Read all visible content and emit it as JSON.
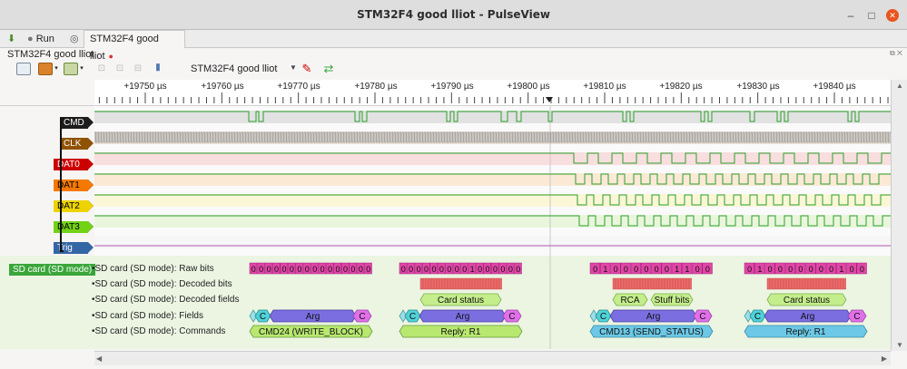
{
  "window": {
    "title": "STM32F4 good lliot - PulseView",
    "buttons": [
      "minimize",
      "maximize",
      "close"
    ]
  },
  "tabs": {
    "run_label": "Run",
    "session_tab": "STM32F4 good lliot"
  },
  "session": {
    "title": "STM32F4 good lliot"
  },
  "toolbar": {
    "device": "STM32F4 good lliot",
    "icons": [
      "open-file-icon",
      "open-dropdown-icon",
      "save-icon",
      "save-dropdown-icon",
      "zoom-in-icon",
      "zoom-out-icon",
      "zoom-fit-icon",
      "cursor-icon",
      "probe-icon",
      "decoder-icon"
    ]
  },
  "ruler": {
    "labels": [
      "+19750 µs",
      "+19760 µs",
      "+19770 µs",
      "+19780 µs",
      "+19790 µs",
      "+19800 µs",
      "+19810 µs",
      "+19820 µs",
      "+19830 µs",
      "+19840 µs"
    ],
    "marker_color": "#222222"
  },
  "channels": [
    {
      "name": "CMD",
      "color": "#1c1c1c",
      "text_color": "#ffffff",
      "bg": "#e2e2e2"
    },
    {
      "name": "CLK",
      "color": "#8f5202",
      "text_color": "#ffffff",
      "bg": "#ebe1d7"
    },
    {
      "name": "DAT0",
      "color": "#cc0000",
      "text_color": "#ffffff",
      "bg": "#f8dede"
    },
    {
      "name": "DAT1",
      "color": "#f57900",
      "text_color": "#000000",
      "bg": "#fbe9d6"
    },
    {
      "name": "DAT2",
      "color": "#edd400",
      "text_color": "#000000",
      "bg": "#fbf6d6"
    },
    {
      "name": "DAT3",
      "color": "#73d216",
      "text_color": "#000000",
      "bg": "#e9f6dc"
    },
    {
      "name": "Trig",
      "color": "#3465a4",
      "text_color": "#ffffff",
      "bg": "#f6f6f6"
    }
  ],
  "decoder": {
    "name": "SD card (SD mode)",
    "color": "#3aa63a",
    "rows": [
      "SD card (SD mode): Raw bits",
      "SD card (SD mode): Decoded bits",
      "SD card (SD mode): Decoded fields",
      "SD card (SD mode): Fields",
      "SD card (SD mode): Commands"
    ],
    "annotations": {
      "raw_bits": [
        {
          "digits": [
            "0",
            "0",
            "0",
            "0",
            "0",
            "0",
            "0",
            "0",
            "0",
            "0",
            "0",
            "0",
            "0",
            "0",
            "0",
            "0"
          ]
        },
        {
          "digits": [
            "0",
            "0",
            "0",
            "0",
            "0",
            "0",
            "0",
            "0",
            "0",
            "1",
            "0",
            "0",
            "0",
            "0",
            "0",
            "0"
          ]
        },
        {
          "digits": [
            "0",
            "1",
            "0",
            "0",
            "0",
            "0",
            "0",
            "0",
            "1",
            "1",
            "0",
            "0"
          ]
        },
        {
          "digits": [
            "0",
            "1",
            "0",
            "0",
            "0",
            "0",
            "0",
            "0",
            "0",
            "1",
            "0",
            "0"
          ]
        }
      ],
      "decoded_fields": [
        "Card status",
        "RCA",
        "Stuff bits",
        "Card status"
      ],
      "fields": {
        "c": "C",
        "arg": "Arg"
      },
      "commands": [
        "CMD24 (WRITE_BLOCK)",
        "Reply: R1",
        "CMD13 (SEND_STATUS)",
        "Reply: R1"
      ]
    }
  }
}
